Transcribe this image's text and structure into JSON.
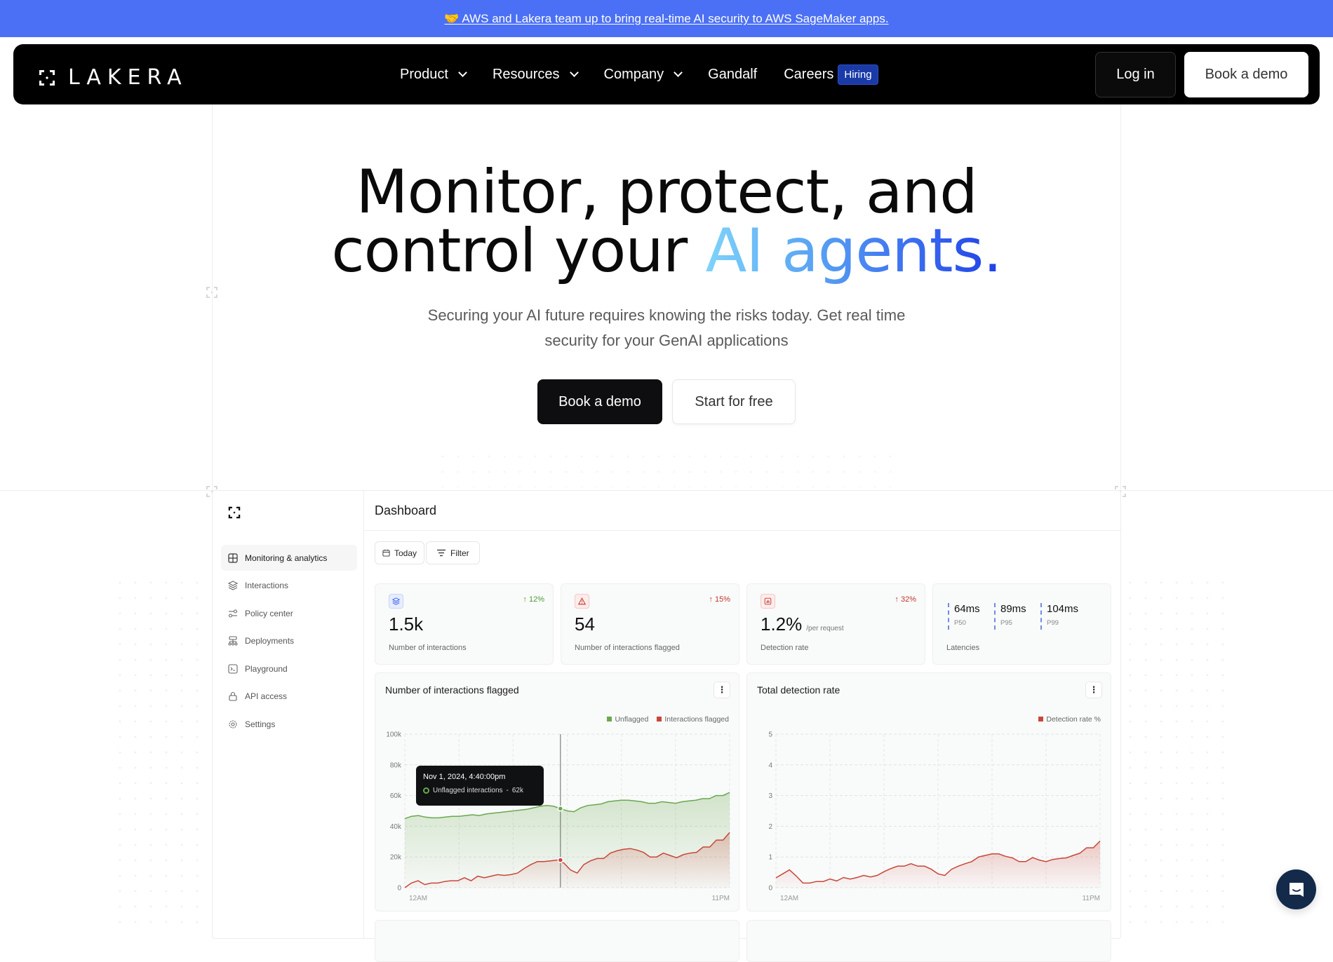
{
  "banner": {
    "emoji": "🤝",
    "text": "AWS and Lakera team up to bring real-time AI security to AWS SageMaker apps."
  },
  "nav": {
    "logo_text": "LAKERA",
    "links": [
      {
        "label": "Product",
        "dropdown": true
      },
      {
        "label": "Resources",
        "dropdown": true
      },
      {
        "label": "Company",
        "dropdown": true
      },
      {
        "label": "Gandalf",
        "dropdown": false
      },
      {
        "label": "Careers",
        "dropdown": false,
        "badge": "Hiring"
      }
    ],
    "login_label": "Log in",
    "demo_label": "Book a demo"
  },
  "hero": {
    "title_line1": "Monitor, protect, and",
    "title_line2_plain": "control your ",
    "title_line2_accent": "AI agents.",
    "subtitle": "Securing your AI future requires knowing the risks today. Get real time security for your GenAI applications",
    "primary_cta": "Book a demo",
    "secondary_cta": "Start for free"
  },
  "dashboard": {
    "title": "Dashboard",
    "sidebar": [
      {
        "label": "Monitoring & analytics",
        "icon": "grid-icon",
        "active": true
      },
      {
        "label": "Interactions",
        "icon": "layers-icon",
        "active": false
      },
      {
        "label": "Policy center",
        "icon": "sliders-icon",
        "active": false
      },
      {
        "label": "Deployments",
        "icon": "network-icon",
        "active": false
      },
      {
        "label": "Playground",
        "icon": "terminal-icon",
        "active": false
      },
      {
        "label": "API access",
        "icon": "lock-icon",
        "active": false
      },
      {
        "label": "Settings",
        "icon": "gear-icon",
        "active": false
      }
    ],
    "filters": {
      "date_label": "Today",
      "filter_label": "Filter"
    },
    "stats": [
      {
        "value": "1.5k",
        "label": "Number of interactions",
        "delta": "12%",
        "trend": "up",
        "tone": "positive",
        "icon": "layers-icon"
      },
      {
        "value": "54",
        "label": "Number of interactions flagged",
        "delta": "15%",
        "trend": "up",
        "tone": "negative",
        "icon": "warning-icon"
      },
      {
        "value": "1.2%",
        "unit": "/per request",
        "label": "Detection rate",
        "delta": "32%",
        "trend": "up",
        "tone": "negative",
        "icon": "chart-icon"
      }
    ],
    "latencies": {
      "label": "Latencies",
      "items": [
        {
          "value": "64ms",
          "percentile": "P50"
        },
        {
          "value": "89ms",
          "percentile": "P95"
        },
        {
          "value": "104ms",
          "percentile": "P99"
        }
      ]
    },
    "colors": {
      "positive": "#4f9a3c",
      "negative": "#c0392b",
      "unflagged": "#6aa84f",
      "flagged": "#c8473a",
      "accent_blue": "#4b70f5"
    }
  },
  "chart_data": [
    {
      "type": "area",
      "title": "Number of interactions flagged",
      "xlabel": "",
      "ylabel": "",
      "x_tick_labels": [
        "12AM",
        "11PM"
      ],
      "y_ticks": [
        0,
        20000,
        40000,
        60000,
        80000,
        100000
      ],
      "y_tick_labels": [
        "0",
        "20k",
        "40k",
        "60k",
        "80k",
        "100k"
      ],
      "ylim": [
        0,
        100000
      ],
      "grid": true,
      "legend_position": "top-right",
      "series": [
        {
          "name": "Unflagged",
          "color": "#6aa84f",
          "values": [
            45000,
            46500,
            47000,
            46000,
            45500,
            45500,
            46000,
            46500,
            46500,
            47000,
            47500,
            47000,
            48000,
            48500,
            49000,
            49500,
            50000,
            50500,
            51000,
            52000,
            53000,
            53500,
            53000,
            51500,
            50000,
            49500,
            52000,
            53500,
            54000,
            54500,
            56000,
            56500,
            57000,
            57000,
            56500,
            56000,
            55000,
            55000,
            56000,
            55500,
            55000,
            56000,
            56500,
            57000,
            58000,
            58000,
            60000,
            60000,
            62000
          ]
        },
        {
          "name": "Interactions flagged",
          "color": "#c8473a",
          "values": [
            0,
            3000,
            4500,
            2000,
            3000,
            3000,
            4000,
            4500,
            4500,
            6500,
            4500,
            7500,
            6500,
            7500,
            8500,
            8000,
            8500,
            9500,
            12500,
            15000,
            17000,
            17000,
            17500,
            18000,
            16000,
            11500,
            9500,
            15000,
            17500,
            19000,
            19000,
            22500,
            24000,
            25000,
            25500,
            24500,
            23000,
            20000,
            20000,
            22500,
            21000,
            19500,
            21500,
            22500,
            23000,
            26500,
            26500,
            31000,
            31000,
            36000
          ]
        }
      ],
      "tooltip": {
        "title": "Nov 1, 2024, 4:40:00pm",
        "series": "Unflagged interactions",
        "value": "62k"
      }
    },
    {
      "type": "area",
      "title": "Total detection rate",
      "xlabel": "",
      "ylabel": "",
      "x_tick_labels": [
        "12AM",
        "11PM"
      ],
      "y_ticks": [
        0,
        1,
        2,
        3,
        4,
        5
      ],
      "y_tick_labels": [
        "0",
        "1",
        "2",
        "3",
        "4",
        "5"
      ],
      "ylim": [
        0,
        5
      ],
      "grid": true,
      "legend_position": "top-right",
      "series": [
        {
          "name": "Detection rate %",
          "color": "#c8473a",
          "values": [
            0.32,
            0.45,
            0.58,
            0.38,
            0.15,
            0.15,
            0.2,
            0.2,
            0.28,
            0.22,
            0.33,
            0.28,
            0.33,
            0.4,
            0.35,
            0.4,
            0.52,
            0.62,
            0.7,
            0.7,
            0.78,
            0.7,
            0.7,
            0.6,
            0.45,
            0.4,
            0.6,
            0.7,
            0.78,
            0.85,
            1.0,
            1.05,
            1.1,
            1.1,
            1.02,
            0.97,
            0.85,
            0.85,
            0.98,
            0.9,
            0.85,
            0.92,
            0.95,
            0.97,
            1.05,
            1.12,
            1.3,
            1.3,
            1.52
          ]
        }
      ]
    }
  ],
  "chat": {
    "icon": "chat-icon"
  }
}
